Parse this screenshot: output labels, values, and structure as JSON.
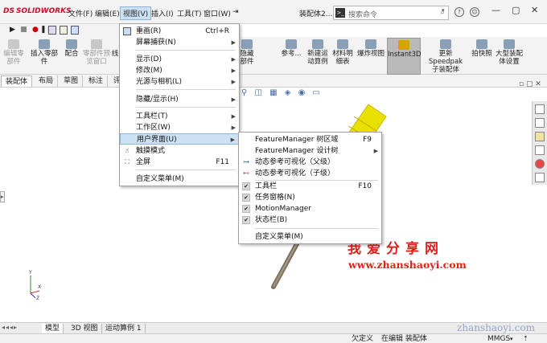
{
  "app": {
    "logo_text": "SOLIDWORKS",
    "logo_mark": "DS"
  },
  "menubar": {
    "items": [
      {
        "label": "文件(F)"
      },
      {
        "label": "编辑(E)"
      },
      {
        "label": "视图(V)"
      },
      {
        "label": "插入(I)"
      },
      {
        "label": "工具(T)"
      },
      {
        "label": "窗口(W)"
      }
    ],
    "pin": "⇥",
    "doc_title": "装配体2....",
    "search_placeholder": "搜索命令",
    "window_controls": [
      "—",
      "▢",
      "✕"
    ]
  },
  "command_manager": {
    "items": [
      {
        "label": "编辑零\n部件",
        "disabled": true
      },
      {
        "label": "插入零部件",
        "disabled": false
      },
      {
        "label": "配合",
        "disabled": false
      },
      {
        "label": "零部件预\n览窗口",
        "disabled": true
      },
      {
        "label": "线",
        "disabled": false
      },
      {
        "label": "隐藏\n部件",
        "disabled": false
      },
      {
        "label": "参考...",
        "disabled": false
      },
      {
        "label": "新建运\n动算例",
        "disabled": false
      },
      {
        "label": "材料明\n细表",
        "disabled": false
      },
      {
        "label": "爆炸视图",
        "disabled": false
      },
      {
        "label": "Instant3D",
        "disabled": false,
        "active": true
      },
      {
        "label": "更新 Speedpak\n子装配体",
        "disabled": false
      },
      {
        "label": "拍快照",
        "disabled": false
      },
      {
        "label": "大型装配\n体设置",
        "disabled": false
      }
    ]
  },
  "tabs": [
    {
      "label": "装配体",
      "active": true
    },
    {
      "label": "布局"
    },
    {
      "label": "草图"
    },
    {
      "label": "标注"
    },
    {
      "label": "评"
    }
  ],
  "view_menu": {
    "items": [
      {
        "label": "重画(R)",
        "accel": "Ctrl+R",
        "icon": "redraw-icon"
      },
      {
        "label": "屏幕捕获(N)",
        "submenu": true
      },
      {
        "label": "显示(D)",
        "submenu": true
      },
      {
        "label": "修改(M)",
        "submenu": true
      },
      {
        "label": "光源与相机(L)",
        "submenu": true
      },
      {
        "label": "隐藏/显示(H)",
        "submenu": true
      },
      {
        "label": "工具栏(T)",
        "submenu": true
      },
      {
        "label": "工作区(W)",
        "submenu": true
      },
      {
        "label": "用户界面(U)",
        "submenu": true,
        "highlighted": true
      },
      {
        "label": "触摸模式",
        "icon": "touch-icon"
      },
      {
        "label": "全屏",
        "accel": "F11",
        "icon": "fullscreen-icon"
      },
      {
        "label": "自定义菜单(M)"
      }
    ]
  },
  "ui_submenu": {
    "items": [
      {
        "label": "FeatureManager 树区域",
        "accel": "F9"
      },
      {
        "label": "FeatureManager 设计树",
        "submenu": true
      },
      {
        "label": "动态参考可视化（父级）",
        "icon": "parent-ref-icon"
      },
      {
        "label": "动态参考可视化（子级）",
        "icon": "child-ref-icon"
      },
      {
        "label": "工具栏",
        "accel": "F10",
        "checked": true
      },
      {
        "label": "任务窗格(N)",
        "checked": true
      },
      {
        "label": "MotionManager",
        "checked": true
      },
      {
        "label": "状态栏(B)",
        "checked": true
      },
      {
        "label": "自定义菜单(M)"
      }
    ]
  },
  "bottom_tabs": [
    {
      "label": "模型",
      "active": true
    },
    {
      "label": "3D 视图"
    },
    {
      "label": "运动算例 1"
    }
  ],
  "statusbar": {
    "undefined": "欠定义",
    "editing": "在编辑 装配体",
    "units": "MMGS",
    "units_arrow": "▾"
  },
  "watermark": {
    "cn": "我爱分享网",
    "url": "www.zhanshaoyi.com",
    "url2": "zhanshaoyi.com"
  },
  "triad": {
    "y": "Y",
    "x": "X",
    "z": "Z"
  },
  "colors": {
    "highlight": "#cde1f4",
    "accent": "#c8102e",
    "model_yellow": "#e8e000",
    "watermark_red": "#e0211b"
  }
}
